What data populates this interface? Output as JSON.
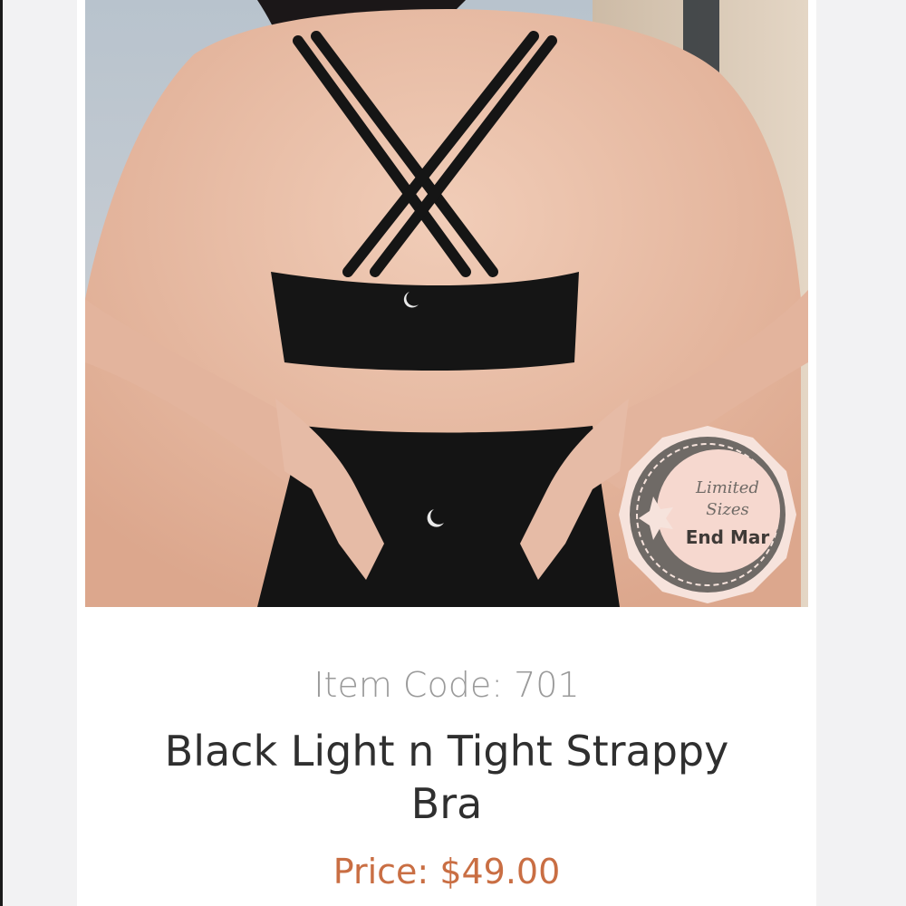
{
  "product": {
    "item_code_label": "Item Code:",
    "item_code": "701",
    "title": "Black Light n Tight Strappy Bra",
    "price_label": "Price:",
    "price": "$49.00"
  },
  "badge": {
    "line1": "Limited",
    "line2": "Sizes",
    "line3": "End Mar"
  },
  "colors": {
    "price": "#c96e43",
    "item_code": "#9a9a9a",
    "title": "#2f2f2f"
  }
}
